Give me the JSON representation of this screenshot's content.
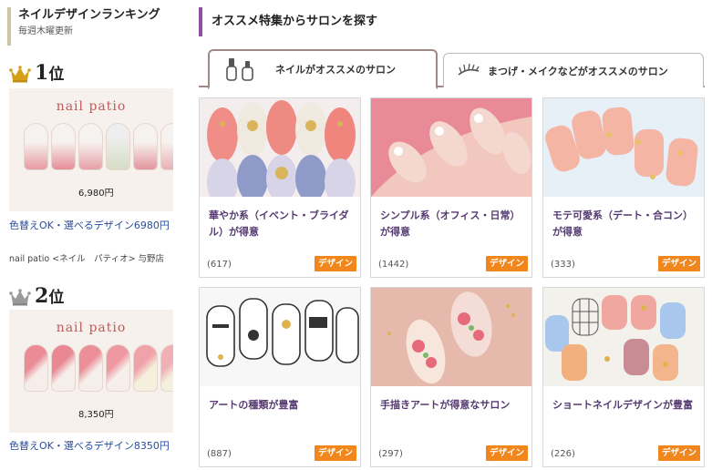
{
  "ranking": {
    "title": "ネイルデザインランキング",
    "subtitle": "毎週木曜更新",
    "items": [
      {
        "rank_num": "1",
        "rank_suffix": "位",
        "crown": "gold-crown-icon",
        "brand": "nail patio",
        "price_tag": "6,980円",
        "link_text": "色替えOK・選べるデザイン6980円",
        "shop": "nail patio <ネイル　パティオ> 与野店"
      },
      {
        "rank_num": "2",
        "rank_suffix": "位",
        "crown": "silver-crown-icon",
        "brand": "nail patio",
        "price_tag": "8,350円",
        "link_text": "色替えOK・選べるデザイン8350円",
        "shop": ""
      }
    ]
  },
  "feature": {
    "title": "オススメ特集からサロンを探す",
    "tabs": [
      {
        "label": "ネイルがオススメのサロン",
        "icon": "nail-polish-icon",
        "active": true
      },
      {
        "label": "まつげ・メイクなどがオススメのサロン",
        "icon": "eyelash-icon",
        "active": false
      }
    ],
    "cards": [
      {
        "title": "華やか系（イベント・ブライダル）が得意",
        "count": "(617)",
        "tag": "デザイン"
      },
      {
        "title": "シンプル系（オフィス・日常）が得意",
        "count": "(1442)",
        "tag": "デザイン"
      },
      {
        "title": "モテ可愛系（デート・合コン）が得意",
        "count": "(333)",
        "tag": "デザイン"
      },
      {
        "title": "アートの種類が豊富",
        "count": "(887)",
        "tag": "デザイン"
      },
      {
        "title": "手描きアートが得意なサロン",
        "count": "(297)",
        "tag": "デザイン"
      },
      {
        "title": "ショートネイルデザインが豊富",
        "count": "(226)",
        "tag": "デザイン"
      }
    ]
  },
  "colors": {
    "link_blue": "#2a4d9b",
    "card_title_purple": "#553a72",
    "tag_orange": "#f0861c",
    "header_accent_purple": "#8e4fa6",
    "gold": "#d4a017",
    "silver": "#9a9a9a"
  }
}
